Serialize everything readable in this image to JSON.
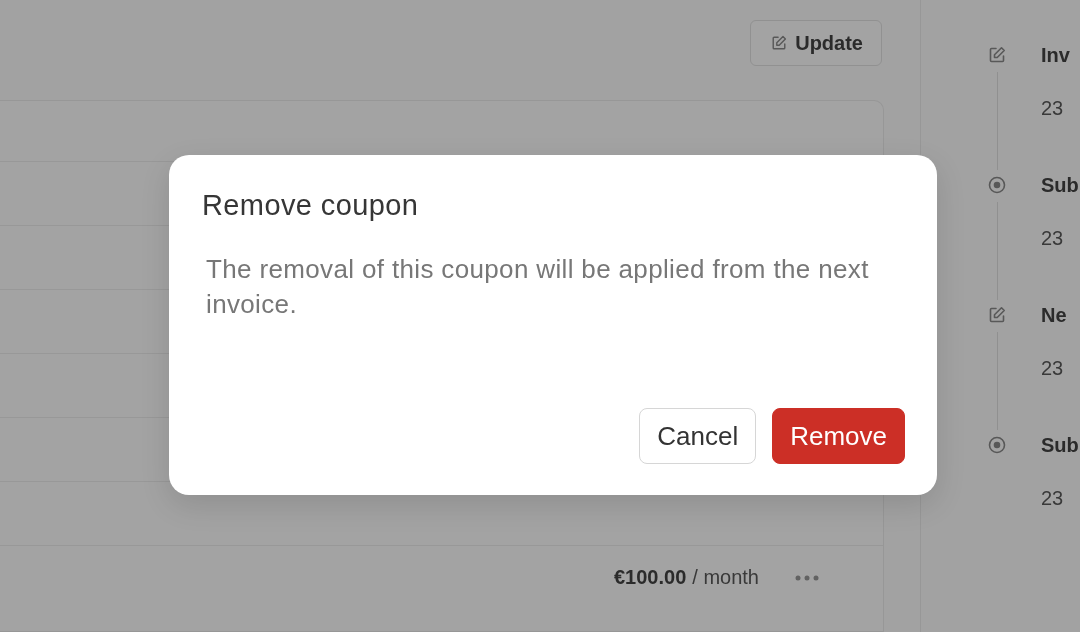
{
  "page": {
    "update_button": {
      "label": "Update"
    },
    "subscription_row": {
      "amount": "€100.00",
      "period": "/ month"
    }
  },
  "activity": [
    {
      "kind": "edit",
      "title": "Inv",
      "date": "23"
    },
    {
      "kind": "event",
      "title": "Sub",
      "date": "23"
    },
    {
      "kind": "edit",
      "title": "Ne",
      "date": "23"
    },
    {
      "kind": "event",
      "title": "Sub",
      "date": "23"
    }
  ],
  "dialog": {
    "title": "Remove coupon",
    "message": "The removal of this coupon will be applied from the next invoice.",
    "buttons": [
      {
        "label": "Cancel",
        "kind": "secondary"
      },
      {
        "label": "Remove",
        "kind": "danger"
      }
    ]
  }
}
